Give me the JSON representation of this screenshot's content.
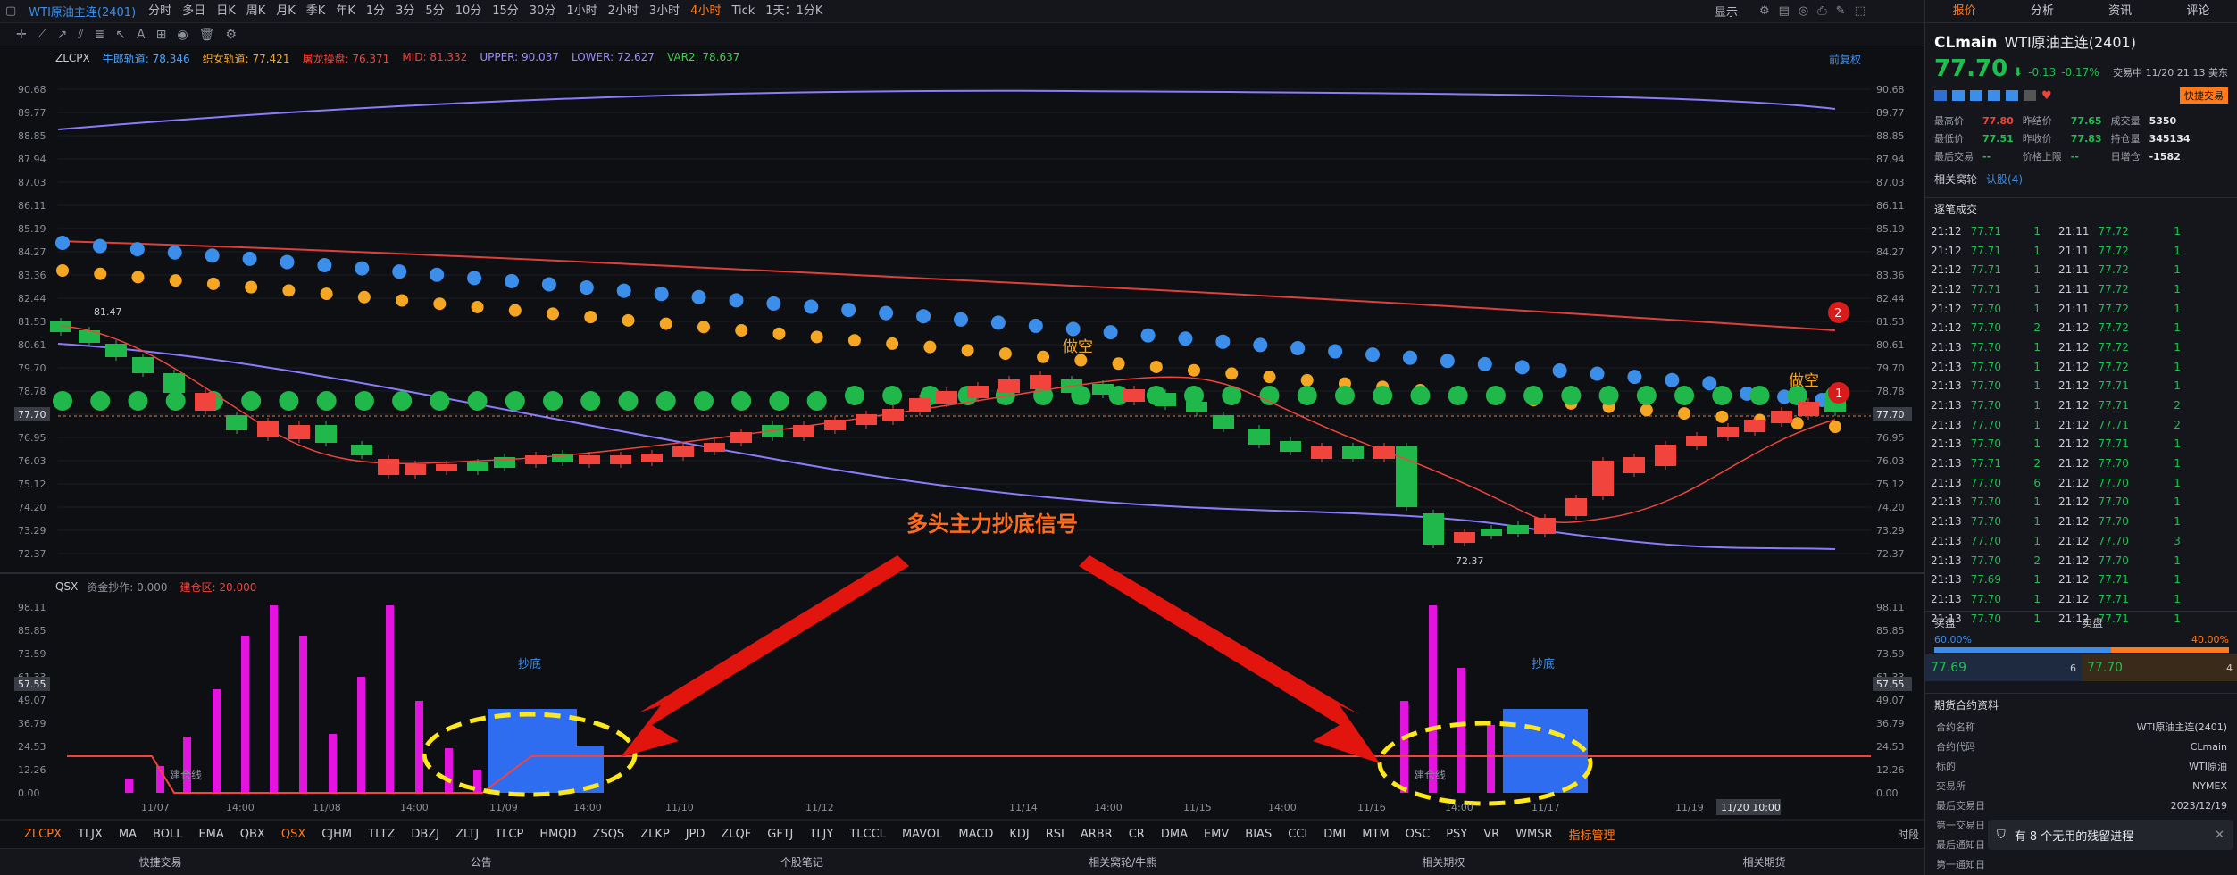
{
  "header": {
    "title": "WTI原油主连(2401)",
    "periods": [
      "分时",
      "多日",
      "日K",
      "周K",
      "月K",
      "季K",
      "年K",
      "1分",
      "3分",
      "5分",
      "10分",
      "15分",
      "30分",
      "1小时",
      "2小时",
      "3小时",
      "4小时",
      "Tick",
      "1天：1分K"
    ],
    "active_period": "4小时",
    "display_label": "显示"
  },
  "main_panel": {
    "indicator_name": "ZLCPX",
    "legend": [
      {
        "label": "牛郎轨道: 78.346",
        "color": "#4aa3ff"
      },
      {
        "label": "织女轨道: 77.421",
        "color": "#f5a623"
      },
      {
        "label": "屠龙操盘: 76.371",
        "color": "#f0443c"
      },
      {
        "label": "MID: 81.332",
        "color": "#f0443c"
      },
      {
        "label": "UPPER: 90.037",
        "color": "#9c8cff"
      },
      {
        "label": "LOWER: 72.627",
        "color": "#9c8cff"
      },
      {
        "label": "VAR2: 78.637",
        "color": "#3fd04f"
      }
    ],
    "adjust_label": "前复权",
    "price_labels": [
      "90.68",
      "89.77",
      "88.85",
      "87.94",
      "87.03",
      "86.11",
      "85.19",
      "84.27",
      "83.36",
      "82.44",
      "81.53",
      "80.61",
      "79.70",
      "78.78",
      "77.70",
      "76.95",
      "76.03",
      "75.12",
      "74.20",
      "73.29",
      "72.37"
    ],
    "current_price": "77.70",
    "high_note": "81.47",
    "low_note": "72.37",
    "annotations": {
      "short1": "做空",
      "short2": "做空",
      "num1": "1",
      "num2": "2"
    },
    "signal_text": "多头主力抄底信号"
  },
  "sub_panel": {
    "indicator_name": "QSX",
    "legend": [
      {
        "label": "资金抄作: 0.000",
        "color": "#8c9099"
      },
      {
        "label": "建仓区: 20.000",
        "color": "#f0443c"
      }
    ],
    "y_labels": [
      "98.11",
      "85.85",
      "73.59",
      "61.33",
      "49.07",
      "36.79",
      "24.53",
      "12.26",
      "0.00"
    ],
    "current_val": "57.55",
    "labels": {
      "bottom1": "抄底",
      "bottom2": "抄底",
      "line1": "建仓线",
      "line2": "建仓线"
    }
  },
  "x_axis": [
    "11/07",
    "14:00",
    "11/08",
    "14:00",
    "11/09",
    "14:00",
    "11/10",
    "11/12",
    "11/14",
    "14:00",
    "11/15",
    "14:00",
    "11/16",
    "14:00",
    "11/17",
    "11/19"
  ],
  "x_axis_current": "11/20 10:00",
  "indicator_tabs": [
    "ZLCPX",
    "TLJX",
    "MA",
    "BOLL",
    "EMA",
    "QBX",
    "QSX",
    "CJHM",
    "TLTZ",
    "DBZJ",
    "ZLTJ",
    "TLCP",
    "HMQD",
    "ZSQS",
    "ZLKP",
    "JPD",
    "ZLQF",
    "GFTJ",
    "TLJY",
    "TLCCL",
    "MAVOL",
    "MACD",
    "KDJ",
    "RSI",
    "ARBR",
    "CR",
    "DMA",
    "EMV",
    "BIAS",
    "CCI",
    "DMI",
    "MTM",
    "OSC",
    "PSY",
    "VR",
    "WMSR",
    "指标管理"
  ],
  "active_indicators": [
    "ZLCPX",
    "QSX"
  ],
  "time_label": "时段",
  "bottom_links": [
    "快捷交易",
    "公告",
    "个股笔记",
    "相关窝轮/牛熊",
    "相关期权",
    "相关期货"
  ],
  "right": {
    "tabs": [
      "报价",
      "分析",
      "资讯",
      "评论"
    ],
    "code": "CLmain",
    "name": "WTI原油主连(2401)",
    "price": "77.70",
    "change": "-0.13",
    "change_pct": "-0.17%",
    "trade_time": "交易中 11/20 21:13 美东",
    "quick_trade": "快捷交易",
    "quote_rows": [
      [
        "最高价",
        "77.80",
        "昨结价",
        "77.65",
        "成交量",
        "5350"
      ],
      [
        "最低价",
        "77.51",
        "昨收价",
        "77.83",
        "持仓量",
        "345134"
      ],
      [
        "最后交易",
        "--",
        "价格上限",
        "--",
        "日增仓",
        "-1582"
      ]
    ],
    "related": [
      "相关窝轮",
      "认股(4)"
    ],
    "ticks_title": "逐笔成交",
    "ticks": [
      [
        "21:12",
        "77.71",
        "1",
        "21:11",
        "77.72",
        "1"
      ],
      [
        "21:12",
        "77.71",
        "1",
        "21:11",
        "77.72",
        "1"
      ],
      [
        "21:12",
        "77.71",
        "1",
        "21:11",
        "77.72",
        "1"
      ],
      [
        "21:12",
        "77.71",
        "1",
        "21:11",
        "77.72",
        "1"
      ],
      [
        "21:12",
        "77.70",
        "1",
        "21:11",
        "77.72",
        "1"
      ],
      [
        "21:12",
        "77.70",
        "2",
        "21:12",
        "77.72",
        "1"
      ],
      [
        "21:13",
        "77.70",
        "1",
        "21:12",
        "77.72",
        "1"
      ],
      [
        "21:13",
        "77.70",
        "1",
        "21:12",
        "77.72",
        "1"
      ],
      [
        "21:13",
        "77.70",
        "1",
        "21:12",
        "77.71",
        "1"
      ],
      [
        "21:13",
        "77.70",
        "1",
        "21:12",
        "77.71",
        "2"
      ],
      [
        "21:13",
        "77.70",
        "1",
        "21:12",
        "77.71",
        "2"
      ],
      [
        "21:13",
        "77.70",
        "1",
        "21:12",
        "77.71",
        "1"
      ],
      [
        "21:13",
        "77.71",
        "2",
        "21:12",
        "77.70",
        "1"
      ],
      [
        "21:13",
        "77.70",
        "6",
        "21:12",
        "77.70",
        "1"
      ],
      [
        "21:13",
        "77.70",
        "1",
        "21:12",
        "77.70",
        "1"
      ],
      [
        "21:13",
        "77.70",
        "1",
        "21:12",
        "77.70",
        "1"
      ],
      [
        "21:13",
        "77.70",
        "1",
        "21:12",
        "77.70",
        "3"
      ],
      [
        "21:13",
        "77.70",
        "2",
        "21:12",
        "77.70",
        "1"
      ],
      [
        "21:13",
        "77.69",
        "1",
        "21:12",
        "77.71",
        "1"
      ],
      [
        "21:13",
        "77.70",
        "1",
        "21:12",
        "77.71",
        "1"
      ],
      [
        "21:13",
        "77.70",
        "1",
        "21:12",
        "77.71",
        "1"
      ]
    ],
    "book_title_buy": "买盘",
    "book_title_sell": "卖盘",
    "buy_pct": "60.00%",
    "sell_pct": "40.00%",
    "bid_price": "77.69",
    "bid_vol": "6",
    "ask_price": "77.70",
    "ask_vol": "4",
    "contract_title": "期货合约资料",
    "contract_rows": [
      [
        "合约名称",
        "WTI原油主连(2401)"
      ],
      [
        "合约代码",
        "CLmain"
      ],
      [
        "标的",
        "WTI原油"
      ],
      [
        "交易所",
        "NYMEX"
      ],
      [
        "最后交易日",
        "2023/12/19"
      ],
      [
        "第一交易日",
        ""
      ],
      [
        "最后通知日",
        ""
      ],
      [
        "第一通知日",
        ""
      ]
    ],
    "toast": "有 8 个无用的残留进程"
  }
}
